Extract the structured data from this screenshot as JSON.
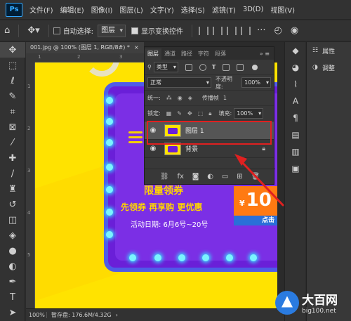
{
  "menubar": {
    "logo": "Ps",
    "items": [
      "文件(F)",
      "编辑(E)",
      "图像(I)",
      "图层(L)",
      "文字(Y)",
      "选择(S)",
      "滤镜(T)",
      "3D(D)",
      "视图(V)"
    ]
  },
  "options": {
    "auto_select_label": "自动选择:",
    "auto_select_value": "图层",
    "show_transform_label": "显示变换控件"
  },
  "tab": {
    "title": "001.jpg @ 100% (图层 1, RGB/8#) *",
    "close": "×"
  },
  "canvas": {
    "title": "限量领券",
    "subtitle": "先领券 再享购 更优惠",
    "date": "活动日期: 6月6号~20号",
    "coupon_currency": "¥",
    "coupon_amount": "10",
    "coupon_footer": "点击"
  },
  "status": {
    "zoom": "100%",
    "info": "暂存盘: 176.6M/4.32G"
  },
  "layers_panel": {
    "tabs": [
      "图层",
      "通道",
      "路径",
      "字符",
      "段落"
    ],
    "more": "»  ≡",
    "kind_filter": "类型",
    "blend_mode": "正常",
    "opacity_label": "不透明度:",
    "opacity_value": "100%",
    "unify_label": "统一:",
    "propagate_label": "传播帧",
    "propagate_value": "1",
    "lock_label": "锁定:",
    "fill_label": "填充:",
    "fill_value": "100%",
    "layers": [
      {
        "name": "图层 1",
        "selected": true
      },
      {
        "name": "背景",
        "selected": false
      }
    ]
  },
  "right_dock": {
    "items": [
      {
        "label": "属性"
      },
      {
        "label": "调整"
      }
    ]
  },
  "watermark": {
    "title": "大百网",
    "url": "big100.net"
  }
}
